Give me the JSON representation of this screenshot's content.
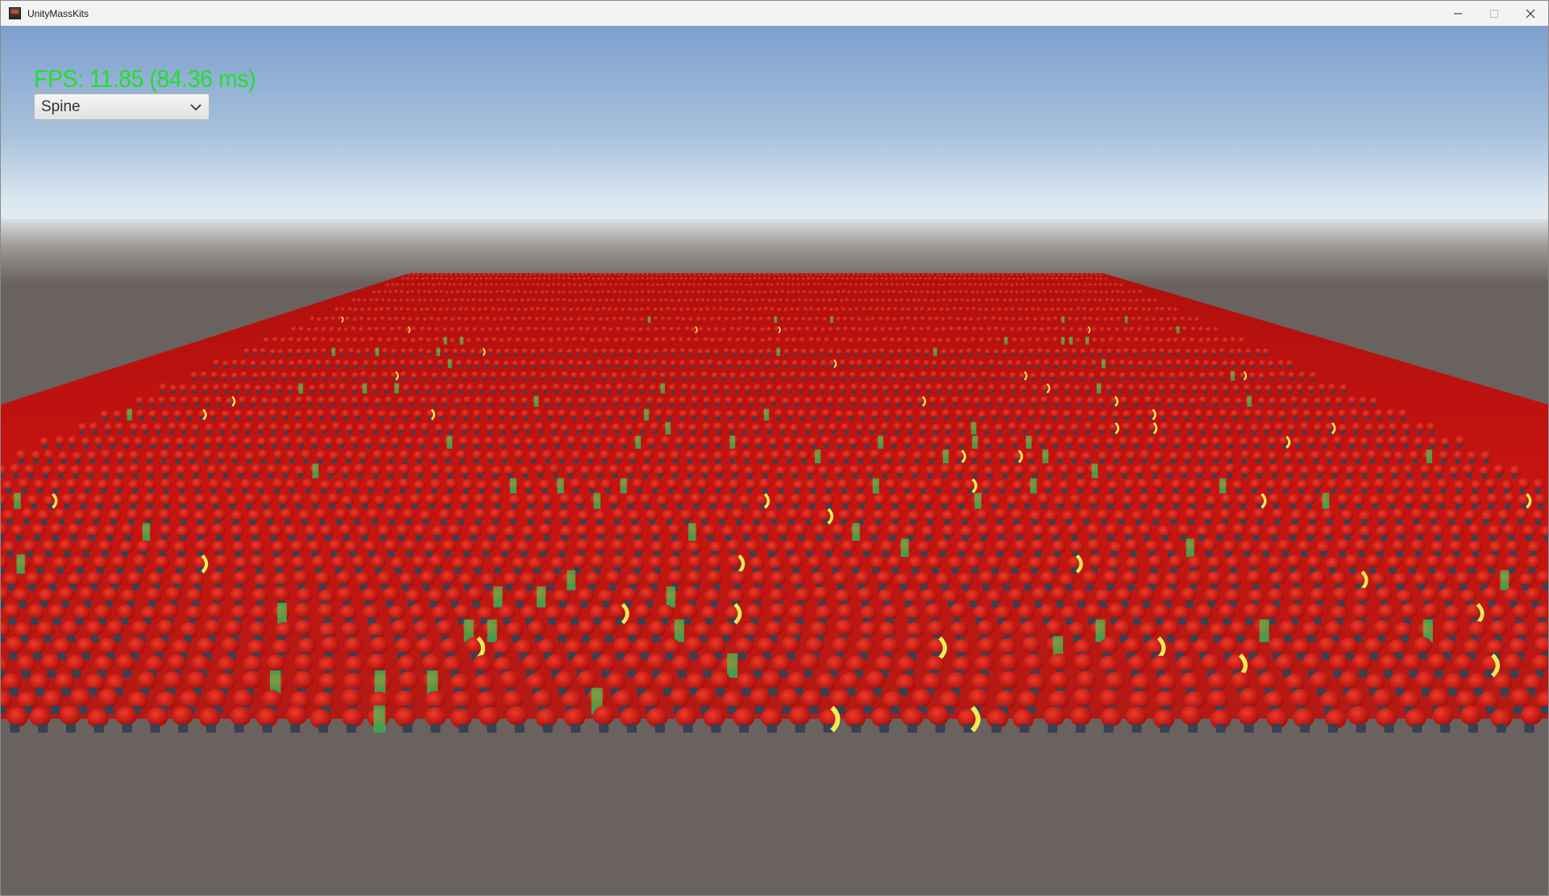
{
  "window": {
    "title": "UnityMassKits",
    "controls": [
      "minimize",
      "maximize",
      "close"
    ]
  },
  "hud": {
    "fps_text": "FPS: 11.85 (84.36 ms)",
    "fps_color": "#22e02a"
  },
  "renderer_select": {
    "selected": "Spine"
  },
  "scene": {
    "sky_colors": [
      "#7fa2cf",
      "#d6e4ef"
    ],
    "ground_color": "#6a625f",
    "character_color": "#d4120e",
    "effect_colors": [
      "#3dd659",
      "#f2ec52"
    ]
  },
  "icons": {
    "app": "app-icon",
    "minimize": "minimize-icon",
    "maximize": "maximize-icon",
    "close": "close-icon",
    "dropdown": "chevron-down-icon"
  }
}
